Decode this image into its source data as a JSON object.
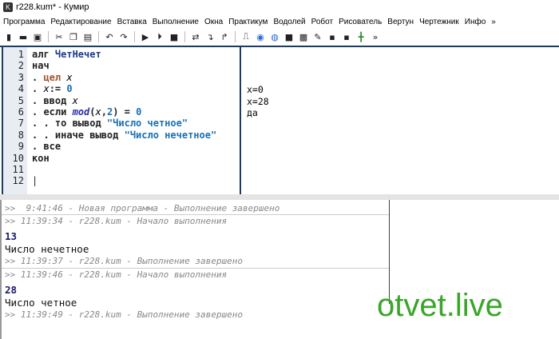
{
  "window": {
    "title": "r228.kum* - Кумир",
    "logo": "K"
  },
  "menu": [
    "Программа",
    "Редактирование",
    "Вставка",
    "Выполнение",
    "Окна",
    "Практикум",
    "Водолей",
    "Робот",
    "Рисователь",
    "Вертун",
    "Чертежник",
    "Инфо",
    "»"
  ],
  "toolbar": {
    "icons": [
      "new-file-icon",
      "open-folder-icon",
      "save-icon",
      "cut-icon",
      "copy-icon",
      "paste-icon",
      "undo-icon",
      "redo-icon",
      "run-icon",
      "step-run-icon",
      "stop-icon",
      "step-over-icon",
      "step-into-icon",
      "step-out-icon",
      "io-icon",
      "robot-icon",
      "vodoley-icon",
      "draw-icon",
      "turtle-icon",
      "painter-icon",
      "drawer-icon",
      "terminal-icon",
      "grid-icon"
    ],
    "more": "»"
  },
  "editor": {
    "line_numbers": [
      "1",
      "2",
      "3",
      "4",
      "5",
      "6",
      "7",
      "8",
      "9",
      "10",
      "11",
      "12"
    ],
    "lines": [
      [
        {
          "t": "алг ",
          "c": "kw"
        },
        {
          "t": "ЧетНечет",
          "c": "nm"
        }
      ],
      [
        {
          "t": "нач",
          "c": "kw"
        }
      ],
      [
        {
          "t": ". ",
          "c": "kw"
        },
        {
          "t": "цел",
          "c": "type"
        },
        {
          "t": " x",
          "c": "var"
        }
      ],
      [
        {
          "t": ". ",
          "c": "kw"
        },
        {
          "t": "x",
          "c": "var"
        },
        {
          "t": ":= ",
          "c": "kw"
        },
        {
          "t": "0",
          "c": "num"
        }
      ],
      [
        {
          "t": ". ввод ",
          "c": "kw"
        },
        {
          "t": "x",
          "c": "var"
        }
      ],
      [
        {
          "t": ". если ",
          "c": "kw"
        },
        {
          "t": "mod",
          "c": "fn"
        },
        {
          "t": "(",
          "c": "kw"
        },
        {
          "t": "x",
          "c": "var"
        },
        {
          "t": ",",
          "c": "kw"
        },
        {
          "t": "2",
          "c": "num"
        },
        {
          "t": ") = ",
          "c": "kw"
        },
        {
          "t": "0",
          "c": "num"
        }
      ],
      [
        {
          "t": ". . то вывод ",
          "c": "kw"
        },
        {
          "t": "\"Число четное\"",
          "c": "str"
        }
      ],
      [
        {
          "t": ". . иначе вывод ",
          "c": "kw"
        },
        {
          "t": "\"Число нечетное\"",
          "c": "str"
        }
      ],
      [
        {
          "t": ". все",
          "c": "kw"
        }
      ],
      [
        {
          "t": "кон",
          "c": "kw"
        }
      ],
      [],
      [
        {
          "t": "|",
          "c": "kw"
        }
      ]
    ],
    "margin": [
      {
        "line": 4,
        "text": "x=0"
      },
      {
        "line": 5,
        "text": "x=28"
      },
      {
        "line": 6,
        "text": "да"
      }
    ]
  },
  "console": [
    {
      "type": "log",
      "text": ">>  9:41:46 - Новая программа - Выполнение завершено"
    },
    {
      "type": "log",
      "text": ">> 11:39:34 - r228.kum - Начало выполнения"
    },
    {
      "type": "inp",
      "text": "13"
    },
    {
      "type": "out",
      "text": "Число нечетное"
    },
    {
      "type": "log",
      "text": ">> 11:39:37 - r228.kum - Выполнение завершено"
    },
    {
      "type": "log",
      "text": ">> 11:39:46 - r228.kum - Начало выполнения"
    },
    {
      "type": "inp",
      "text": "28"
    },
    {
      "type": "out",
      "text": "Число четное"
    },
    {
      "type": "log",
      "text": ">> 11:39:49 - r228.kum - Выполнение завершено"
    }
  ],
  "watermark": "otvet.live"
}
